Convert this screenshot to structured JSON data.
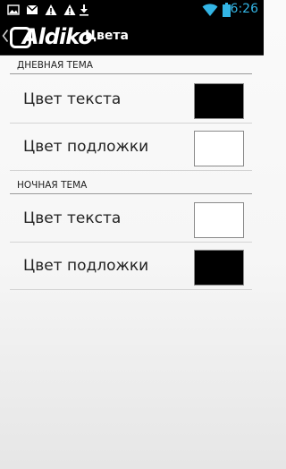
{
  "status_bar": {
    "time": "6:26",
    "icons": [
      "image-icon",
      "gmail-icon",
      "warning-icon",
      "download-icon",
      "wifi-icon",
      "battery-icon"
    ]
  },
  "action_bar": {
    "logo_text": "Aldiko",
    "title": "Цвета"
  },
  "sections": [
    {
      "header": "ДНЕВНАЯ ТЕМА",
      "items": [
        {
          "label": "Цвет текста",
          "color": "#000000"
        },
        {
          "label": "Цвет подложки",
          "color": "#ffffff"
        }
      ]
    },
    {
      "header": "НОЧНАЯ ТЕМА",
      "items": [
        {
          "label": "Цвет текста",
          "color": "#ffffff"
        },
        {
          "label": "Цвет подложки",
          "color": "#000000"
        }
      ]
    }
  ]
}
